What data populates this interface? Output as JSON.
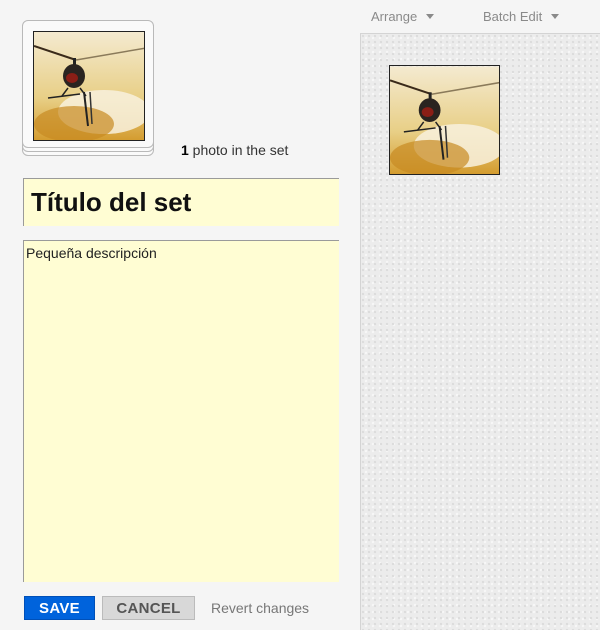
{
  "set": {
    "photo_count": "1",
    "photo_count_suffix": " photo in the set",
    "title": "Título del set",
    "description": "Pequeña descripción"
  },
  "actions": {
    "save_label": "SAVE",
    "cancel_label": "CANCEL",
    "revert_label": "Revert changes"
  },
  "toolbar": {
    "arrange_label": "Arrange",
    "batch_edit_label": "Batch Edit"
  },
  "icons": {
    "photo": "helicopter-photo",
    "dropdown": "chevron-down-icon"
  },
  "colors": {
    "save_button": "#0063dc",
    "field_background": "#fffdd3",
    "cancel_button": "#d8d8d8"
  }
}
